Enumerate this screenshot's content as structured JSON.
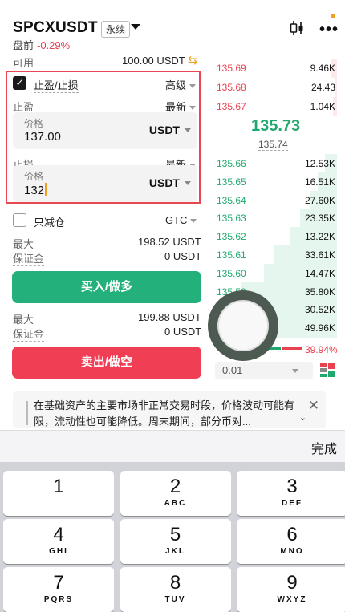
{
  "header": {
    "pair": "SPCXUSDT",
    "contract_type": "永续",
    "session": "盘前",
    "change": "-0.29%"
  },
  "account": {
    "available_label": "可用",
    "available_value": "100.00 USDT"
  },
  "tpsl": {
    "checked": true,
    "label": "止盈/止损",
    "mode": "高级",
    "take_profit": {
      "label": "止盈",
      "trigger_type": "最新",
      "price_label": "价格",
      "price_value": "137.00",
      "unit": "USDT"
    },
    "stop_loss": {
      "label": "止损",
      "trigger_type": "最新",
      "price_label": "价格",
      "price_value": "132",
      "unit": "USDT"
    }
  },
  "reduce_only": {
    "checked": false,
    "label": "只减仓",
    "tif": "GTC"
  },
  "buy_side": {
    "max_label": "最大",
    "max_value": "198.52 USDT",
    "margin_label": "保证金",
    "margin_value": "0 USDT",
    "button": "买入/做多"
  },
  "sell_side": {
    "max_label": "最大",
    "max_value": "199.88 USDT",
    "margin_label": "保证金",
    "margin_value": "0 USDT",
    "button": "卖出/做空"
  },
  "orderbook": {
    "asks": [
      {
        "price": "135.69",
        "qty": "9.46K",
        "depth": 0.05
      },
      {
        "price": "135.68",
        "qty": "24.43",
        "depth": 0.02
      },
      {
        "price": "135.67",
        "qty": "1.04K",
        "depth": 0.03
      }
    ],
    "last_price": "135.73",
    "mark_price": "135.74",
    "bids": [
      {
        "price": "135.66",
        "qty": "12.53K",
        "depth": 0.1
      },
      {
        "price": "135.65",
        "qty": "16.51K",
        "depth": 0.16
      },
      {
        "price": "135.64",
        "qty": "27.60K",
        "depth": 0.22
      },
      {
        "price": "135.63",
        "qty": "23.35K",
        "depth": 0.3
      },
      {
        "price": "135.62",
        "qty": "13.22K",
        "depth": 0.38
      },
      {
        "price": "135.61",
        "qty": "33.61K",
        "depth": 0.52
      },
      {
        "price": "135.60",
        "qty": "14.47K",
        "depth": 0.6
      },
      {
        "price": "135.59",
        "qty": "35.80K",
        "depth": 0.78
      },
      {
        "price": "135.58",
        "qty": "30.52K",
        "depth": 0.88
      },
      {
        "price": "135.57",
        "qty": "49.96K",
        "depth": 1.0
      }
    ],
    "sell_ratio": "39.94%",
    "step": "0.01"
  },
  "notice": {
    "text": "在基础资产的主要市场非正常交易时段，价格波动可能有限，流动性也可能降低。周末期间，部分币对..."
  },
  "keyboard": {
    "done_label": "完成",
    "keys": [
      {
        "digit": "1",
        "letters": ""
      },
      {
        "digit": "2",
        "letters": "ABC"
      },
      {
        "digit": "3",
        "letters": "DEF"
      },
      {
        "digit": "4",
        "letters": "GHI"
      },
      {
        "digit": "5",
        "letters": "JKL"
      },
      {
        "digit": "6",
        "letters": "MNO"
      },
      {
        "digit": "7",
        "letters": "PQRS"
      },
      {
        "digit": "8",
        "letters": "TUV"
      },
      {
        "digit": "9",
        "letters": "WXYZ"
      }
    ]
  },
  "colors": {
    "buy": "#23b07a",
    "sell": "#f03e55",
    "accent": "#f0a020",
    "highlight_border": "#e84752"
  }
}
